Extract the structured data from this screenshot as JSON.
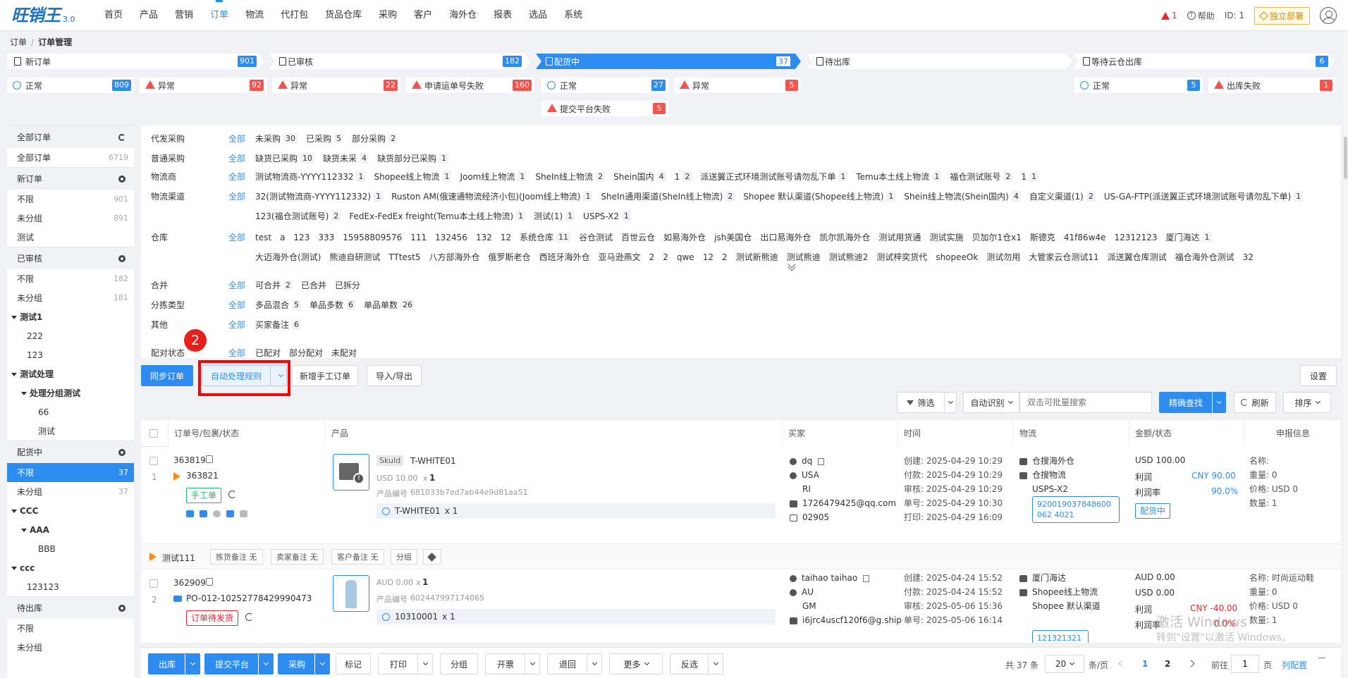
{
  "app": {
    "logo": "旺销王",
    "version": "3.0"
  },
  "menu": [
    "首页",
    "产品",
    "营销",
    "订单",
    "物流",
    "代打包",
    "货品仓库",
    "采购",
    "客户",
    "海外仓",
    "报表",
    "选品",
    "系统"
  ],
  "active_menu": "订单",
  "topright": {
    "alert_count": "1",
    "help": "帮助",
    "id": "ID: 1",
    "deploy": "独立部署"
  },
  "breadcrumb": [
    "订单",
    "订单管理"
  ],
  "stages": [
    {
      "label": "新订单",
      "count": "901"
    },
    {
      "label": "已审核",
      "count": "182"
    },
    {
      "label": "配货中",
      "count": "37"
    },
    {
      "label": "待出库",
      "count": ""
    },
    {
      "label": "等待云仓出库",
      "count": "6"
    }
  ],
  "substages": {
    "s1": [
      {
        "label": "正常",
        "count": "809"
      },
      {
        "label": "异常",
        "count": "92"
      }
    ],
    "s2": [
      {
        "label": "异常",
        "count": "22"
      },
      {
        "label": "申请运单号失败",
        "count": "160"
      }
    ],
    "s3": [
      {
        "label": "正常",
        "count": "27"
      },
      {
        "label": "异常",
        "count": "5"
      },
      {
        "label": "提交平台失败",
        "count": "5"
      }
    ],
    "s5": [
      {
        "label": "正常",
        "count": "5"
      },
      {
        "label": "出库失败",
        "count": "1"
      }
    ]
  },
  "sidebar": {
    "all_title": "全部订单",
    "all_item": "全部订单",
    "all_count": "6719",
    "new_title": "新订单",
    "new_items": [
      {
        "label": "不限",
        "count": "901"
      },
      {
        "label": "未分组",
        "count": "891"
      },
      {
        "label": "测试",
        "count": ""
      }
    ],
    "audited_title": "已审核",
    "audited_items": [
      {
        "label": "不限",
        "count": "182"
      },
      {
        "label": "未分组",
        "count": "181"
      }
    ],
    "test1": "测试1",
    "test1_children": [
      "222",
      "123"
    ],
    "testproc": "测试处理",
    "testproc_child": "处理分组测试",
    "testproc_grand": [
      "66",
      "测试"
    ],
    "picking_title": "配货中",
    "picking_items": [
      {
        "label": "不限",
        "count": "37"
      },
      {
        "label": "未分组",
        "count": "37"
      }
    ],
    "ccc": "CCC",
    "aaa": "AAA",
    "bbb": "BBB",
    "ccc2": "ccc",
    "c123": "123123",
    "out_title": "待出库",
    "out_items": [
      "不限",
      "未分组"
    ]
  },
  "filters": {
    "all": "全部",
    "rows": [
      {
        "label": "代发采购",
        "opts": [
          [
            "未采购",
            "30"
          ],
          [
            "已采购",
            "5"
          ],
          [
            "部分采购",
            "2"
          ]
        ]
      },
      {
        "label": "普通采购",
        "opts": [
          [
            "缺货已采购",
            "10"
          ],
          [
            "缺货未采",
            "4"
          ],
          [
            "缺货部分已采购",
            "1"
          ]
        ]
      },
      {
        "label": "物流商",
        "opts": [
          [
            "测试物流商-YYYY112332",
            "1"
          ],
          [
            "Shopee线上物流",
            "1"
          ],
          [
            "Joom线上物流",
            "1"
          ],
          [
            "SheIn线上物流",
            "2"
          ],
          [
            "Shein国内",
            "4"
          ],
          [
            "1",
            "2"
          ],
          [
            "派送翼正式环境测试账号请勿乱下单",
            "1"
          ],
          [
            "Temu本土线上物流",
            "1"
          ],
          [
            "福仓测试账号",
            "2"
          ],
          [
            "1",
            "1"
          ]
        ]
      },
      {
        "label": "物流渠道",
        "opts": [
          [
            "32(测试物流商-YYYY112332)",
            "1"
          ],
          [
            "Ruston AM(俄速通物流经济小包)(Joom线上物流)",
            "1"
          ],
          [
            "SheIn通用渠道(SheIn线上物流)",
            "2"
          ],
          [
            "Shopee 默认渠道(Shopee线上物流)",
            "1"
          ],
          [
            "Shein线上物流(Shein国内)",
            "4"
          ],
          [
            "自定义渠道(1)",
            "2"
          ],
          [
            "US-GA-FTP(派送翼正式环境测试账号请勿乱下单)",
            "1"
          ]
        ]
      },
      {
        "label": "",
        "opts": [
          [
            "123(福仓测试账号)",
            "2"
          ],
          [
            "FedEx-FedEx freight(Temu本土线上物流)",
            "1"
          ],
          [
            "测试(1)",
            "1"
          ],
          [
            "USPS-X2",
            "1"
          ]
        ]
      },
      {
        "label": "仓库",
        "opts": [
          [
            "test",
            ""
          ],
          [
            "a",
            ""
          ],
          [
            "123",
            ""
          ],
          [
            "333",
            ""
          ],
          [
            "15958809576",
            ""
          ],
          [
            "111",
            ""
          ],
          [
            "132456",
            ""
          ],
          [
            "132",
            ""
          ],
          [
            "12",
            ""
          ],
          [
            "系统仓库",
            "11"
          ],
          [
            "谷仓测试",
            ""
          ],
          [
            "百世云仓",
            ""
          ],
          [
            "如易海外仓",
            ""
          ],
          [
            "jsh美国仓",
            ""
          ],
          [
            "出口易海外仓",
            ""
          ],
          [
            "凯尔凯海外仓",
            ""
          ],
          [
            "测试用货通",
            ""
          ],
          [
            "测试实施",
            ""
          ],
          [
            "贝加尔1仓x1",
            ""
          ],
          [
            "斯德克",
            ""
          ],
          [
            "41f86w4e",
            ""
          ],
          [
            "12312123",
            ""
          ],
          [
            "厦门海达",
            "1"
          ]
        ]
      },
      {
        "label": "",
        "opts": [
          [
            "大迈海外仓(测试)",
            ""
          ],
          [
            "熊迪自研测试",
            ""
          ],
          [
            "TTtest5",
            ""
          ],
          [
            "八方部海外仓",
            ""
          ],
          [
            "俄罗斯老仓",
            ""
          ],
          [
            "西班牙海外仓",
            ""
          ],
          [
            "亚马逊燕文",
            ""
          ],
          [
            "2",
            ""
          ],
          [
            "2",
            ""
          ],
          [
            "qwe",
            ""
          ],
          [
            "12",
            ""
          ],
          [
            "2",
            ""
          ],
          [
            "测试新熊迪",
            ""
          ],
          [
            "测试熊迪",
            ""
          ],
          [
            "测试熊迪2",
            ""
          ],
          [
            "测试梓奕货代",
            ""
          ],
          [
            "shopeeOk",
            ""
          ],
          [
            "测试勿用",
            ""
          ],
          [
            "大管家云仓测试11",
            ""
          ],
          [
            "派送翼仓库测试",
            ""
          ],
          [
            "福仓海外仓测试",
            ""
          ],
          [
            "32",
            ""
          ]
        ]
      },
      {
        "label": "合并",
        "opts": [
          [
            "可合并",
            "2"
          ],
          [
            "已合并",
            ""
          ],
          [
            "已拆分",
            ""
          ]
        ]
      },
      {
        "label": "分拣类型",
        "opts": [
          [
            "多品混合",
            "5"
          ],
          [
            "单品多数",
            "6"
          ],
          [
            "单品单数",
            "26"
          ]
        ]
      },
      {
        "label": "其他",
        "opts": [
          [
            "买家备注",
            "6"
          ]
        ]
      },
      {
        "label": "配对状态",
        "opts": [
          [
            "已配对",
            ""
          ],
          [
            "部分配对",
            ""
          ],
          [
            "未配对",
            ""
          ]
        ]
      }
    ]
  },
  "annotation_number": "2",
  "toolbar": {
    "sync": "同步订单",
    "auto_rule": "自动处理规则",
    "new_manual": "新增手工订单",
    "import_export": "导入/导出",
    "settings": "设置",
    "filter": "筛选",
    "auto_detect": "自动识别",
    "search_placeholder": "双击可批量搜索",
    "precise": "精确查找",
    "refresh": "刷新",
    "sort": "排序"
  },
  "table": {
    "headers": [
      "订单号/包裹/状态",
      "产品",
      "买家",
      "时间",
      "物流",
      "金额/状态",
      "申报信息"
    ],
    "rows": [
      {
        "index": "1",
        "order_no": "363819",
        "package": "363821",
        "status_tag": "手工单",
        "sku_label": "SkuId",
        "sku": "T-WHITE01",
        "price": "USD 10.00",
        "qty": "x",
        "qty_num": "1",
        "prod_code_label": "产品编号",
        "prod_code": "681033b7ed7ab44e9d81aa51",
        "combo": "T-WHITE01",
        "combo_qty": "x 1",
        "buyer": "dq",
        "country": "USA",
        "region": "RI",
        "email": "1726479425@qq.com",
        "zip": "02905",
        "times": [
          "创建: 2025-04-29 10:29",
          "付款: 2025-04-29 10:29",
          "审核: 2025-04-29 10:29",
          "单号: 2025-04-29 10:30",
          "打印: 2025-04-29 16:09"
        ],
        "warehouse": "仓搜海外仓",
        "logistics": "仓搜物流",
        "channel": "USPS-X2",
        "tracking": "920019037848600062 4021",
        "amount": "USD 100.00",
        "profit_label": "利润",
        "profit": "CNY 90.00",
        "rate_label": "利润率",
        "rate": "90.0%",
        "state": "配货中",
        "decl": [
          "名称:",
          "重量: 0",
          "价格: USD 0",
          "数量: 1"
        ],
        "notes": {
          "user": "测试111",
          "pick": "拣货备注 无",
          "seller": "卖家备注 无",
          "customer": "客户备注 无",
          "group": "分组"
        }
      },
      {
        "index": "2",
        "order_no": "362909",
        "package": "PO-012-10252778429990473",
        "status_tag": "订单待发货",
        "price": "AUD 0.00",
        "qty": "x",
        "qty_num": "1",
        "prod_code_label": "产品编号",
        "prod_code": "602447997174065",
        "combo": "10310001",
        "combo_qty": "x 1",
        "buyer": "taihao taihao",
        "country": "AU",
        "region": "GM",
        "email": "i6jrc4uscf120f6@g.ship",
        "times": [
          "创建: 2025-04-24 15:52",
          "付款: 2025-04-24 15:52",
          "审核: 2025-05-06 15:36",
          "单号: 2025-05-06 16:14"
        ],
        "warehouse": "厦门海达",
        "logistics": "Shopee线上物流",
        "channel": "Shopee 默认渠道",
        "tracking": "121321321",
        "amount": "AUD 0.00",
        "amount2": "USD 0.00",
        "profit_label": "利润",
        "profit": "CNY -40.00",
        "rate_label": "利润率",
        "rate": "0.0%",
        "decl": [
          "名称: 时尚运动鞋",
          "重量: 0",
          "价格: USD 0",
          "数量: 1"
        ]
      }
    ]
  },
  "bottombar": {
    "buttons": [
      "出库",
      "提交平台",
      "采购",
      "标记",
      "打印",
      "分组",
      "开票",
      "退回",
      "更多",
      "反选"
    ],
    "total": "共 37 条",
    "page_size": "20",
    "per_page": "条/页",
    "pages": [
      "1",
      "2"
    ],
    "goto": "前往",
    "goto_val": "1",
    "page_unit": "页",
    "config": "列配置"
  },
  "watermark": {
    "line1": "激活 Windows",
    "line2": "转到\"设置\"以激活 Windows。"
  },
  "colors": {
    "primary": "#2d8cf0",
    "danger": "#f5544d",
    "annotation": "#e8201c"
  }
}
